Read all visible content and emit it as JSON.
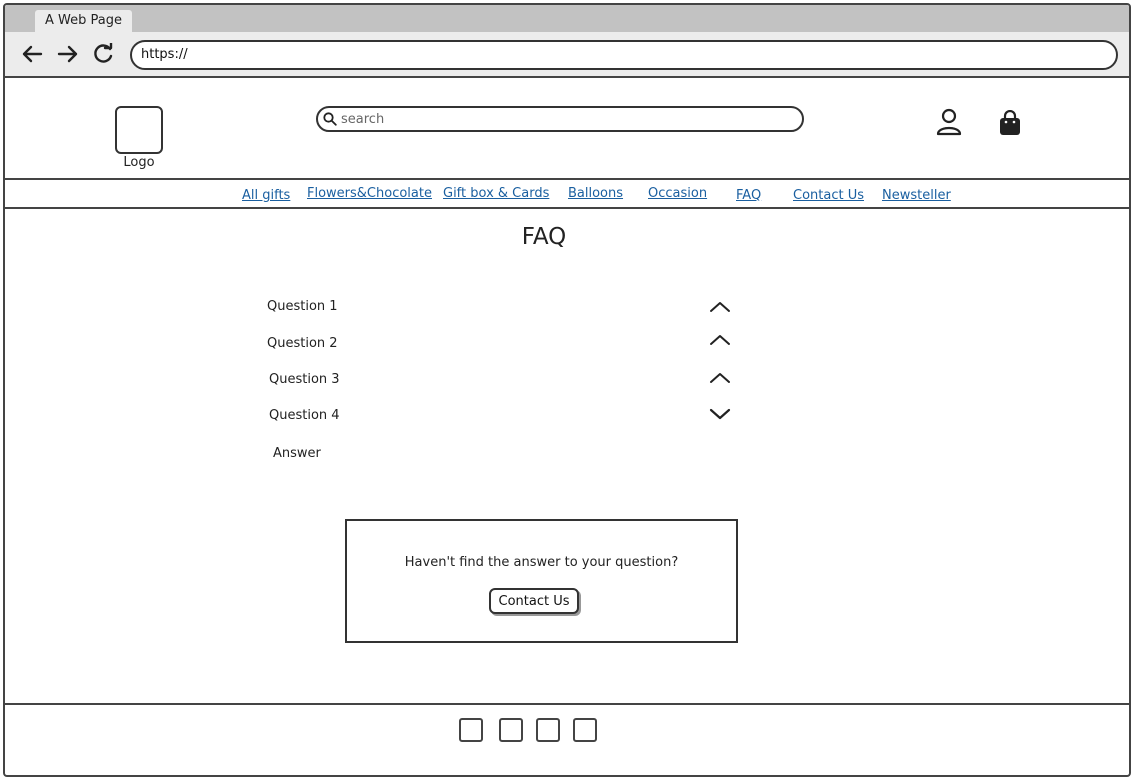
{
  "browser": {
    "tab_title": "A Web Page",
    "url": "https://"
  },
  "header": {
    "logo_label": "Logo",
    "search_placeholder": "search",
    "account_icon": "user-icon",
    "cart_icon": "shopping-bag-icon"
  },
  "nav": {
    "items": [
      {
        "label": "All gifts"
      },
      {
        "label": "Flowers&Chocolate"
      },
      {
        "label": "Gift box & Cards"
      },
      {
        "label": "Balloons"
      },
      {
        "label": "Occasion"
      },
      {
        "label": "FAQ"
      },
      {
        "label": "Contact Us"
      },
      {
        "label": "Newsteller"
      }
    ]
  },
  "faq": {
    "title": "FAQ",
    "questions": [
      {
        "label": "Question 1",
        "expanded": false
      },
      {
        "label": "Question 2",
        "expanded": false
      },
      {
        "label": "Question 3",
        "expanded": false
      },
      {
        "label": "Question 4",
        "expanded": true
      }
    ],
    "answer": "Answer"
  },
  "contact_box": {
    "text": "Haven't find the answer to your question?",
    "button_label": "Contact  Us"
  },
  "footer": {
    "social_icons": [
      "social-icon-1",
      "social-icon-2",
      "social-icon-3",
      "social-icon-4"
    ]
  },
  "colors": {
    "link": "#1a5fa0",
    "border": "#333333",
    "chrome": "#ececec"
  }
}
